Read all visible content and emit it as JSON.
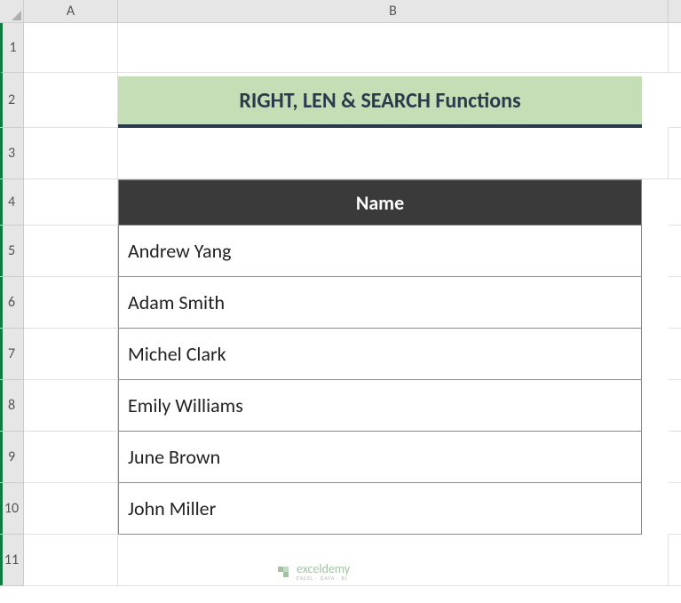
{
  "columns": [
    "A",
    "B"
  ],
  "rows": [
    "1",
    "2",
    "3",
    "4",
    "5",
    "6",
    "7",
    "8",
    "9",
    "10",
    "11"
  ],
  "title": "RIGHT, LEN & SEARCH Functions",
  "table_header": "Name",
  "names": [
    "Andrew Yang",
    "Adam Smith",
    "Michel Clark",
    "Emily Williams",
    "June Brown",
    "John Miller"
  ],
  "watermark": {
    "name": "exceldemy",
    "sub": "EXCEL · DATA · BI"
  },
  "chart_data": {
    "type": "table",
    "title": "RIGHT, LEN & SEARCH Functions",
    "columns": [
      "Name"
    ],
    "rows": [
      [
        "Andrew Yang"
      ],
      [
        "Adam Smith"
      ],
      [
        "Michel Clark"
      ],
      [
        "Emily Williams"
      ],
      [
        "June Brown"
      ],
      [
        "John Miller"
      ]
    ]
  }
}
